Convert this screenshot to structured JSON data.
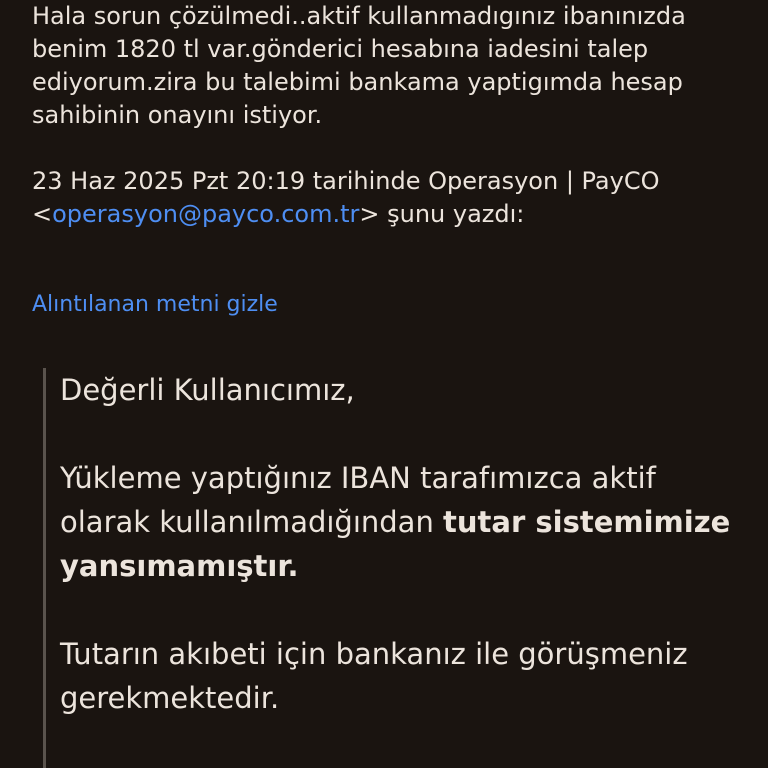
{
  "reply": {
    "body": "Hala sorun çözülmedi..aktif kullanmadıgınız ibanınızda benim 1820 tl var.gönderici hesabına iadesini talep ediyorum.zira bu talebimi bankama yaptigımda hesap sahibinin onayını istiyor.",
    "attribution_prefix": "23 Haz 2025 Pzt 20:19 tarihinde Operasyon | PayCO <",
    "attribution_email": "operasyon@payco.com.tr",
    "attribution_suffix": "> şunu yazdı:"
  },
  "hide_quoted_text_label": "Alıntılanan metni gizle",
  "quoted": {
    "greeting": "Değerli Kullanıcımız,",
    "para1_lead": "Yükleme yaptığınız IBAN tarafımızca aktif olarak kullanılmadığından ",
    "para1_bold": "tutar sistemimize yansımamıştır.",
    "para2": "Tutarın akıbeti için bankanız ile görüşmeniz gerekmektedir."
  },
  "colors": {
    "background": "#1a1410",
    "text": "#ece4dc",
    "link": "#4e8ef2",
    "quote_bar": "#5a534d"
  }
}
